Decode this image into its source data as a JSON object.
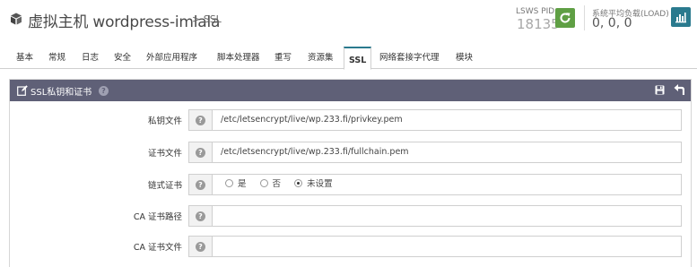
{
  "header": {
    "title": "虚拟主机 wordpress-imlala",
    "subtitle": "> SSL",
    "pid_label": "LSWS PID",
    "pid_value": "18135",
    "load_label": "系统平均负载(LOAD)",
    "load_value": "0, 0, 0"
  },
  "tabs": [
    {
      "label": "基本",
      "active": false
    },
    {
      "label": "常规",
      "active": false
    },
    {
      "label": "日志",
      "active": false
    },
    {
      "label": "安全",
      "active": false
    },
    {
      "label": "外部应用程序",
      "active": false
    },
    {
      "label": "脚本处理器",
      "active": false
    },
    {
      "label": "重写",
      "active": false
    },
    {
      "label": "资源集",
      "active": false
    },
    {
      "label": "SSL",
      "active": true
    },
    {
      "label": "网络套接字代理",
      "active": false
    },
    {
      "label": "模块",
      "active": false
    }
  ],
  "panel": {
    "title": "SSL私钥和证书",
    "rows": {
      "private_key": {
        "label": "私钥文件",
        "value": "/etc/letsencrypt/live/wp.233.fi/privkey.pem"
      },
      "cert_file": {
        "label": "证书文件",
        "value": "/etc/letsencrypt/live/wp.233.fi/fullchain.pem"
      },
      "chained_cert": {
        "label": "链式证书",
        "options": [
          "是",
          "否",
          "未设置"
        ],
        "selected": "未设置"
      },
      "ca_path": {
        "label": "CA 证书路径",
        "value": ""
      },
      "ca_file": {
        "label": "CA 证书文件",
        "value": ""
      }
    }
  },
  "colors": {
    "panel_header": "#5f6077",
    "reload_button": "#5f9f44",
    "chart_button": "#2a7a8e",
    "active_tab_accent": "#2a7a8e"
  },
  "icons": {
    "title_icon": "cube-icon",
    "reload": "refresh-icon",
    "load_chart": "bar-chart-icon",
    "panel_edit": "edit-icon",
    "panel_help": "help-icon",
    "panel_save": "save-icon",
    "panel_back": "back-arrow-icon"
  }
}
